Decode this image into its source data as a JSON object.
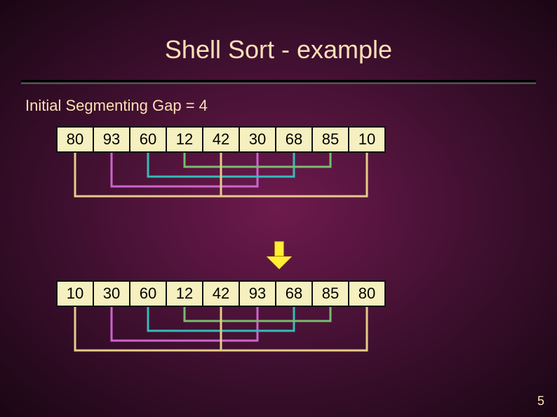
{
  "title": "Shell Sort - example",
  "subtitle": "Initial Segmenting Gap = 4",
  "page_number": "5",
  "array_before": [
    "80",
    "93",
    "60",
    "12",
    "42",
    "30",
    "68",
    "85",
    "10"
  ],
  "array_after": [
    "10",
    "30",
    "60",
    "12",
    "42",
    "93",
    "68",
    "85",
    "80"
  ],
  "gap": 4,
  "link_colors_before": [
    "#e6cc88",
    "#cc66cc",
    "#33bdb8",
    "#79bc6f"
  ],
  "link_colors_after": [
    "#e6cc88",
    "#cc66cc",
    "#33bdb8",
    "#79bc6f"
  ]
}
